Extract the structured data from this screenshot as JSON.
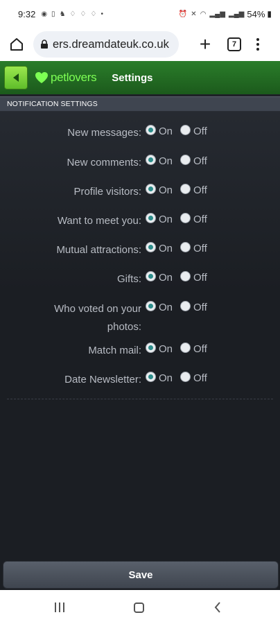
{
  "status_bar": {
    "time": "9:32",
    "battery": "54%"
  },
  "browser": {
    "url": "ers.dreamdateuk.co.uk",
    "tab_count": "7"
  },
  "header": {
    "logo_text": "petlovers",
    "title": "Settings"
  },
  "section": {
    "title": "NOTIFICATION SETTINGS"
  },
  "options": {
    "on_label": "On",
    "off_label": "Off"
  },
  "settings": [
    {
      "label": "New messages:",
      "value": "On"
    },
    {
      "label": "New comments:",
      "value": "On"
    },
    {
      "label": "Profile visitors:",
      "value": "On"
    },
    {
      "label": "Want to meet you:",
      "value": "On"
    },
    {
      "label": "Mutual attractions:",
      "value": "On"
    },
    {
      "label": "Gifts:",
      "value": "On"
    },
    {
      "label": "Who voted on your photos:",
      "value": "On"
    },
    {
      "label": "Match mail:",
      "value": "On"
    },
    {
      "label": "Date Newsletter:",
      "value": "On"
    }
  ],
  "save_label": "Save",
  "colors": {
    "header_green": "#1c5a1c",
    "logo_green": "#7dff54",
    "radio_checked": "#2c8c8a",
    "background": "#1e2127"
  }
}
